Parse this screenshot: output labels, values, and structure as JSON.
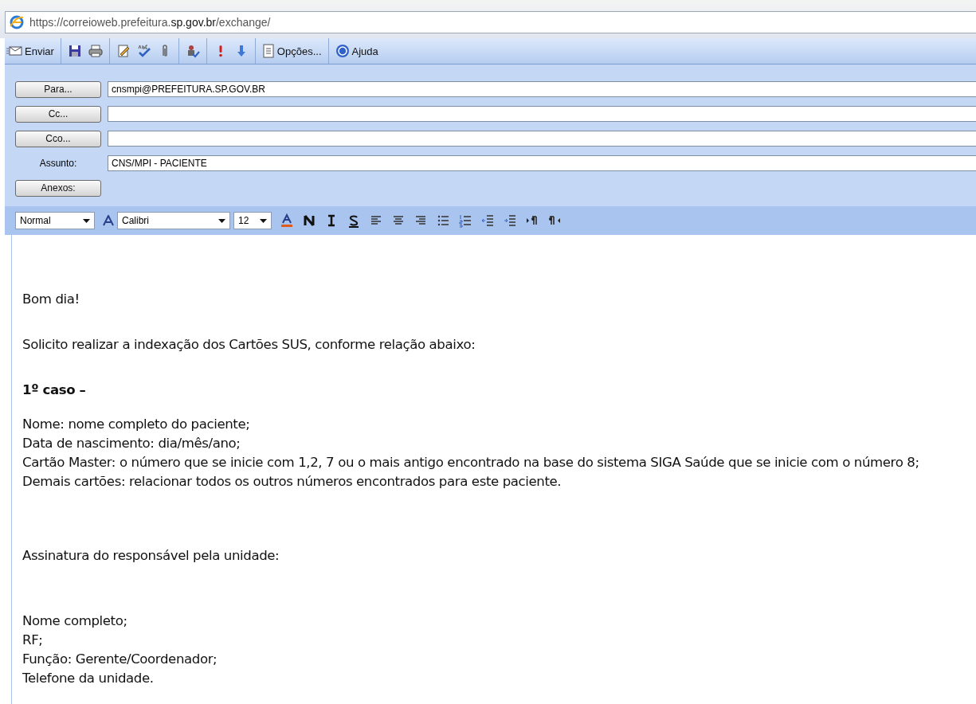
{
  "address_bar": {
    "url": "https://correioweb.prefeitura.**sp.gov.br**/exchange/"
  },
  "toolbar": {
    "send": "Enviar",
    "options": "Opções...",
    "help": "Ajuda"
  },
  "header": {
    "recipients": [
      {
        "button": "Para...",
        "value": "cnsmpi@PREFEITURA.SP.GOV.BR"
      },
      {
        "button": "Cc..."
      },
      {
        "button": "Cco..."
      }
    ],
    "subject_label": "Assunto:",
    "subject": "CNS/MPI - PACIENTE",
    "attachments": "Anexos:"
  },
  "format_bar": {
    "style": "Normal",
    "font": "Calibri",
    "size": "12"
  },
  "body": {
    "paragraphs": [
      {
        "kind": "normal",
        "lines": [
          "Bom dia!"
        ]
      },
      {
        "kind": "normal",
        "lines": [
          "Solicito realizar a indexação dos Cartões SUS, conforme relação abaixo:"
        ]
      },
      {
        "kind": "heading",
        "lines": [
          "1º caso –"
        ]
      },
      {
        "kind": "normal",
        "lines": [
          "Nome: nome completo do paciente;",
          "Data de nascimento: dia/mês/ano;",
          "Cartão Master: o número que se inicie com 1,2, 7 ou o mais antigo encontrado na base do sistema SIGA Saúde que se inicie com o número 8;",
          "Demais cartões: relacionar todos os outros números encontrados para este paciente."
        ]
      },
      {
        "kind": "normal",
        "lines": [
          "Assinatura do responsável pela unidade:"
        ]
      },
      {
        "kind": "normal",
        "lines": [
          "Nome completo;",
          "RF;",
          "Função: Gerente/Coordenador;",
          "Telefone da unidade."
        ]
      }
    ]
  }
}
